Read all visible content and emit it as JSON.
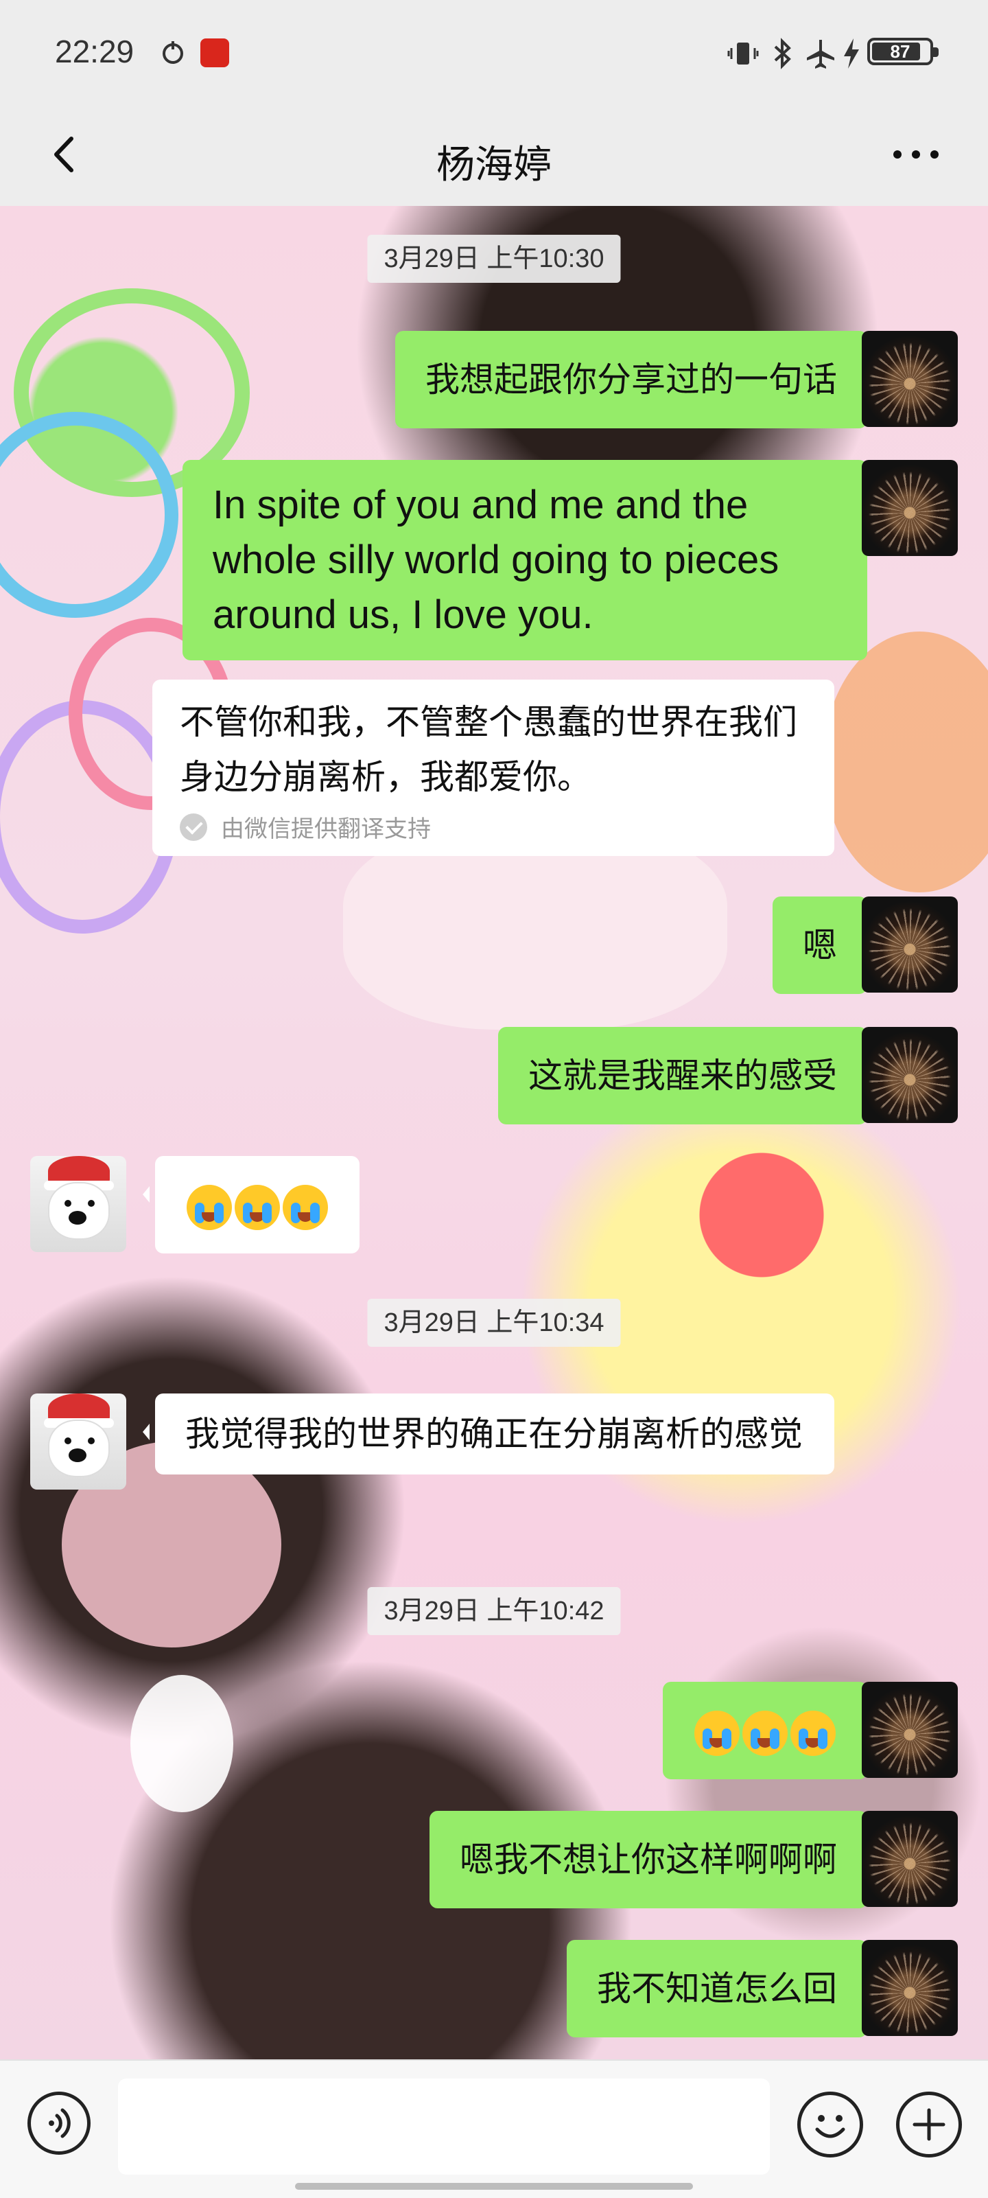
{
  "status_bar": {
    "time": "22:29",
    "battery": "87"
  },
  "nav": {
    "title": "杨海婷"
  },
  "messages": {
    "ts1": "3月29日 上午10:30",
    "m1": "我想起跟你分享过的一句话",
    "m2": "In spite of you and me and the whole silly world going to pieces around us, I love you.",
    "m2_translation": "不管你和我，不管整个愚蠢的世界在我们身边分崩离析，我都爱你。",
    "translation_note": "由微信提供翻译支持",
    "m3": "嗯",
    "m4": "这就是我醒来的感受",
    "ts2": "3月29日 上午10:34",
    "m6": "我觉得我的世界的确正在分崩离析的感觉",
    "ts3": "3月29日 上午10:42",
    "m8": "嗯我不想让你这样啊啊啊",
    "m9": "我不知道怎么回"
  },
  "icons": {
    "cry_emoji": "loudly-crying-face"
  },
  "colors": {
    "my_bubble": "#95ec69",
    "her_bubble": "#ffffff",
    "bar_bg": "#ededed"
  }
}
